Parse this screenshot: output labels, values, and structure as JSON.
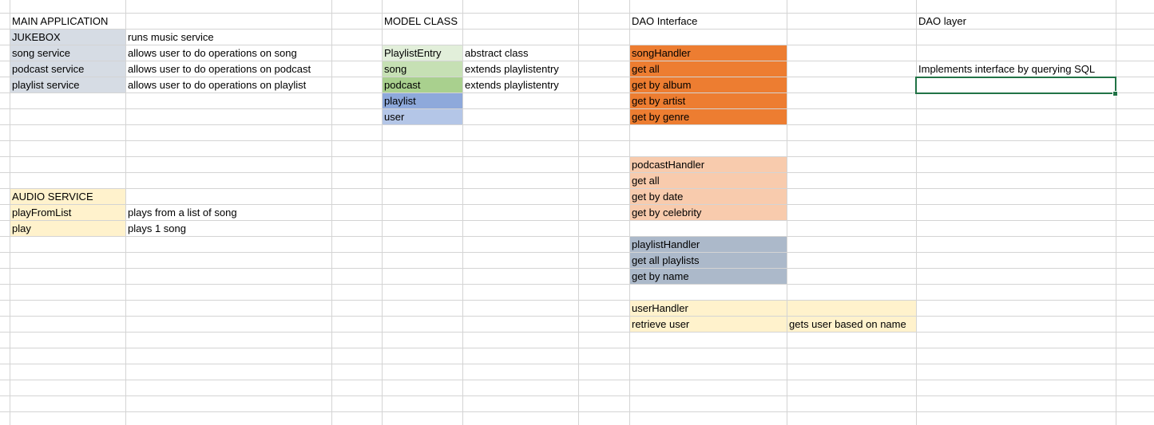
{
  "main_application": {
    "header": "MAIN APPLICATION",
    "rows": [
      {
        "name": "JUKEBOX",
        "desc": "runs music service"
      },
      {
        "name": "song service",
        "desc": "allows user to do operations on song"
      },
      {
        "name": "podcast service",
        "desc": "allows user to do operations on podcast"
      },
      {
        "name": "playlist service",
        "desc": "allows user to do operations on playlist"
      }
    ],
    "fill": "#d6dce4"
  },
  "audio_service": {
    "header": "AUDIO SERVICE",
    "rows": [
      {
        "name": "playFromList",
        "desc": "plays from a list of song"
      },
      {
        "name": "play",
        "desc": "plays 1 song"
      }
    ],
    "fill": "#fff2cc"
  },
  "model_class": {
    "header": "MODEL CLASS",
    "rows": [
      {
        "name": "PlaylistEntry",
        "desc": "abstract class",
        "fill": "#e2efda"
      },
      {
        "name": "song",
        "desc": "extends playlistentry",
        "fill": "#c6e0b4"
      },
      {
        "name": "podcast",
        "desc": "extends playlistentry",
        "fill": "#a9d08e"
      },
      {
        "name": "playlist",
        "desc": "",
        "fill": "#8ea9db"
      },
      {
        "name": "user",
        "desc": "",
        "fill": "#b4c6e7"
      }
    ]
  },
  "dao_interface": {
    "header": "DAO Interface",
    "song_handler": {
      "fill": "#ed7d31",
      "items": [
        "songHandler",
        "get all",
        "get by album",
        "get by artist",
        "get by genre"
      ]
    },
    "podcast_handler": {
      "fill": "#f8cbad",
      "items": [
        "podcastHandler",
        "get all",
        "get by date",
        "get by celebrity"
      ]
    },
    "playlist_handler": {
      "fill": "#acb9ca",
      "items": [
        "playlistHandler",
        "get all playlists",
        "get by name"
      ]
    },
    "user_handler": {
      "fill": "#fff2cc",
      "items": [
        "userHandler",
        "retrieve user"
      ],
      "note": "gets user based on name"
    }
  },
  "dao_layer": {
    "header": "DAO layer",
    "note": "Implements interface by querying SQL"
  }
}
